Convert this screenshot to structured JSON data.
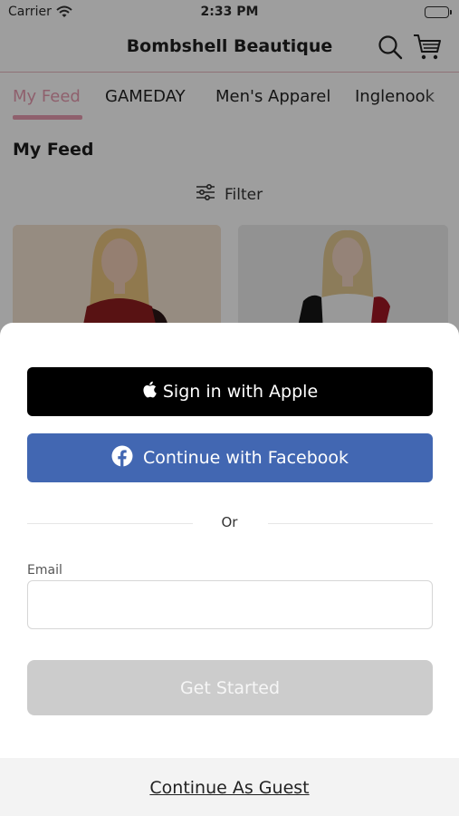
{
  "status_bar": {
    "carrier": "Carrier",
    "time": "2:33 PM"
  },
  "header": {
    "title": "Bombshell Beautique",
    "icons": [
      "search-icon",
      "cart-icon"
    ]
  },
  "tabs": [
    {
      "label": "My Feed",
      "active": true
    },
    {
      "label": "GAMEDAY",
      "active": false
    },
    {
      "label": "Men's Apparel",
      "active": false
    },
    {
      "label": "Inglenook",
      "active": false
    }
  ],
  "feed": {
    "heading": "My Feed",
    "filter_label": "Filter"
  },
  "colors": {
    "accent_pink": "#e79cb0",
    "facebook_blue": "#4267b2",
    "apple_black": "#000000",
    "disabled_gray": "#cccccc"
  },
  "login_sheet": {
    "apple_label": "Sign in with Apple",
    "facebook_label": "Continue with Facebook",
    "or_text": "Or",
    "email_label": "Email",
    "email_value": "",
    "get_started_label": "Get Started",
    "guest_label": "Continue As Guest"
  }
}
